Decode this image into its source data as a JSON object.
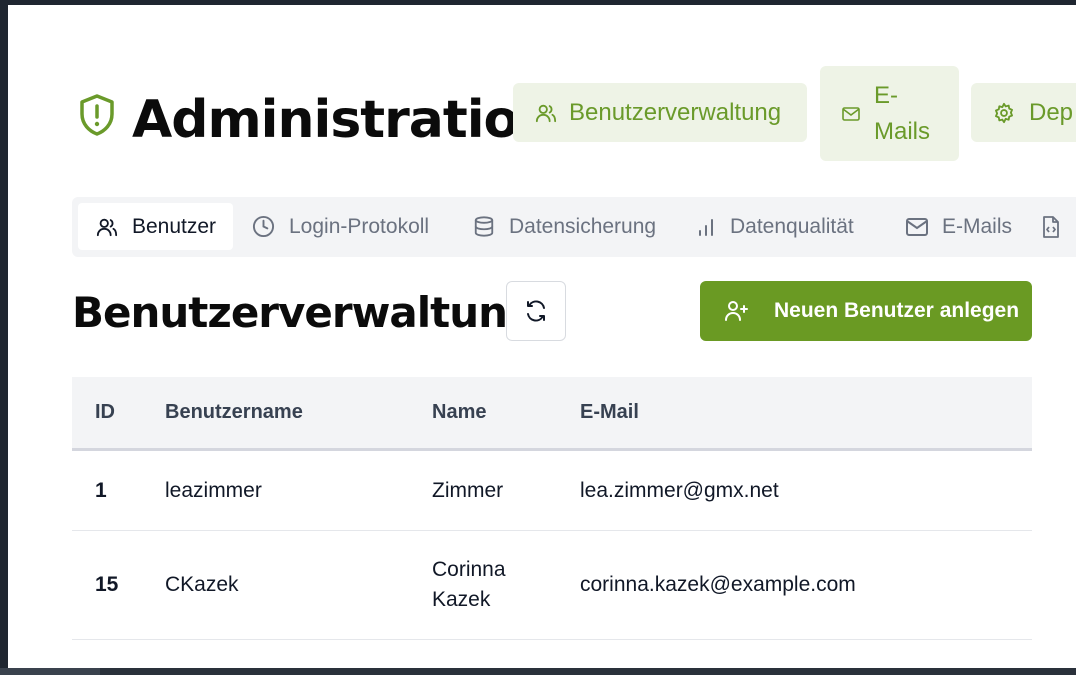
{
  "app": {
    "title": "Administration"
  },
  "header_buttons": [
    {
      "label": "Benutzerverwaltung",
      "icon": "users-icon"
    },
    {
      "label": "E-Mails",
      "icon": "mail-icon"
    },
    {
      "label": "Dep",
      "icon": "gear-icon"
    }
  ],
  "tabs": [
    {
      "label": "Benutzer",
      "icon": "users-icon",
      "active": true
    },
    {
      "label": "Login-Protokoll",
      "icon": "clock-icon"
    },
    {
      "label": "Datensicherung",
      "icon": "database-icon"
    },
    {
      "label": "Datenqualität",
      "icon": "bar-chart-icon"
    },
    {
      "label": "E-Mails",
      "icon": "mail-icon"
    },
    {
      "label": "",
      "icon": "file-code-icon"
    }
  ],
  "section": {
    "title": "Benutzerverwaltung",
    "add_button_label": "Neuen Benutzer anlegen"
  },
  "table": {
    "columns": [
      "ID",
      "Benutzername",
      "Name",
      "E-Mail"
    ],
    "rows": [
      {
        "id": "1",
        "username": "leazimmer",
        "name_line1": "Zimmer",
        "name_line2": "",
        "email": "lea.zimmer@gmx.net"
      },
      {
        "id": "15",
        "username": "CKazek",
        "name_line1": "Corinna",
        "name_line2": "Kazek",
        "email": "corinna.kazek@example.com"
      }
    ]
  },
  "colors": {
    "accent": "#6a9a23",
    "accent_light": "#eef3e6",
    "text": "#111827",
    "muted": "#6b7280"
  }
}
